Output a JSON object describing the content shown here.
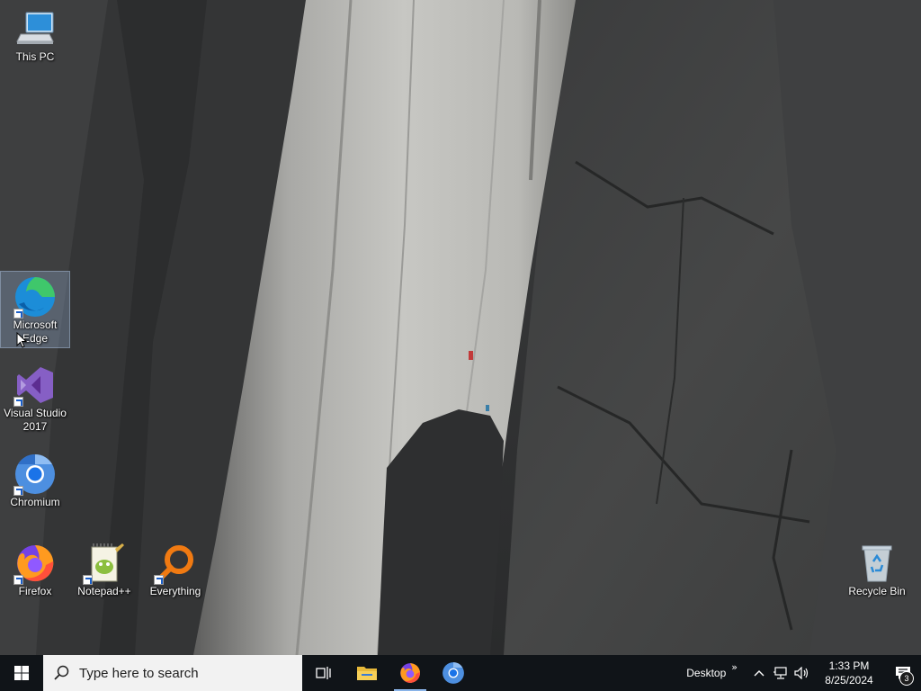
{
  "desktop": {
    "icons": [
      {
        "label": "This PC",
        "icon": "computer-icon"
      },
      {
        "label": "Microsoft Edge",
        "icon": "edge-icon"
      },
      {
        "label": "Visual Studio 2017",
        "icon": "visual-studio-icon"
      },
      {
        "label": "Chromium",
        "icon": "chromium-icon"
      },
      {
        "label": "Firefox",
        "icon": "firefox-icon"
      },
      {
        "label": "Notepad++",
        "icon": "notepadpp-icon"
      },
      {
        "label": "Everything",
        "icon": "everything-icon"
      },
      {
        "label": "Recycle Bin",
        "icon": "recycle-bin-icon"
      }
    ]
  },
  "taskbar": {
    "search_placeholder": "Type here to search",
    "toolbar_label": "Desktop",
    "toolbar_chevron": "»",
    "tray_arrow": "^",
    "time": "1:33 PM",
    "date": "8/25/2024",
    "notification_count": "3",
    "pinned": [
      {
        "name": "task-view",
        "icon": "task-view-icon"
      },
      {
        "name": "file-explorer",
        "icon": "folder-icon"
      },
      {
        "name": "firefox",
        "icon": "firefox-icon",
        "active": true
      },
      {
        "name": "chromium",
        "icon": "chromium-icon"
      }
    ]
  }
}
